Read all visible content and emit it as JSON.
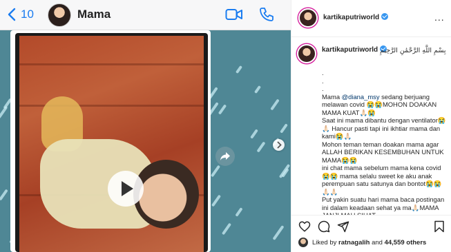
{
  "chat": {
    "back_count": "10",
    "contact_name": "Mama",
    "icons": {
      "back": "chevron-left-icon",
      "video": "video-call-icon",
      "phone": "phone-icon",
      "play": "play-icon",
      "share": "share-icon",
      "next": "chevron-right-icon"
    },
    "accent_color": "#1a7cf0"
  },
  "post": {
    "username": "kartikaputriworld",
    "verified": true,
    "more_label": "...",
    "caption": {
      "username": "kartikaputriworld",
      "arabic": "بِسْمِ اللَّهِ الرَّحْمَٰنِ الرَّحِيمِ",
      "dot": ".",
      "text_before_mention": "Mama ",
      "mention": "@diana_msy",
      "text_after_mention": " sedang berjuang melawan covid 😭😭MOHON DOAKAN MAMA KUAT🙏🏻😭\nSaat ini mama dibantu dengan ventilator😭🙏🏻 Hancur pasti tapi ini ikhtiar mama dan kami😭🙏🏻\nMohon teman teman doakan mama agar ALLAH BERIKAN KESEMBUHAN UNTUK MAMA😭😭\nini chat mama sebelum mama kena covid😭😭 mama selalu sweet ke aku anak perempuan satu satunya dan bontot😭😭🙏🏻🙏🏻\nPut yakin suatu hari mama baca postingan ini dalam keadaan sehat ya ma🙏🏻MAMA JANJI MAU SIHAT"
    },
    "likes": {
      "prefix": "Liked by ",
      "user": "ratnagalih",
      "conj": " and ",
      "others": "44,559 others"
    },
    "icons": {
      "like": "heart-icon",
      "comment": "comment-icon",
      "share": "send-icon",
      "save": "bookmark-icon"
    }
  }
}
